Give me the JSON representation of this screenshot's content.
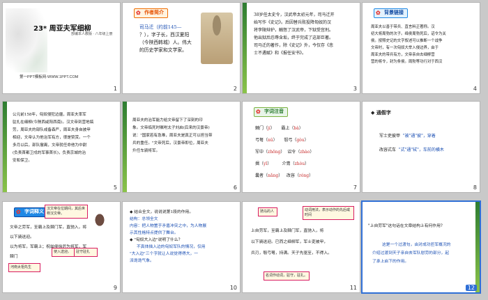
{
  "slides": [
    {
      "number": "1",
      "title": "23* 周亚夫军细柳",
      "subtitle": "部编本人教版 · 八年级上册",
      "footer": "第一PPT模板网-WWW.1PPT.COM"
    },
    {
      "number": "2",
      "tag": "作者简介",
      "line1": "司马迁（约前145—",
      "line2": "？），字子长，西汉夏阳",
      "line3": "（今陕西韩城）人。伟大",
      "line4": "的历史学家和文学家。"
    },
    {
      "number": "3",
      "line1": "38岁任太史令，汉武帝太初元年，司马迁开",
      "line2": "始写作《史记》。后因替兵败投降匈奴的汉",
      "line3": "将李陵辩护，触怒了汉武帝，下狱受宫刑。",
      "line4": "他出狱后忍辱含垢，终于完成了这部巨著。",
      "line5": "司马迁的著作，除《史记》外，今仅存《悲",
      "line6": "士不遇赋》和《报任安书》。"
    },
    {
      "number": "4",
      "tag": "背景链接",
      "line1": "周亚夫以善于带兵、直言料正著称。汉",
      "line2": "初大将周勃的次子。绛侯周勃死后，诏令为关",
      "line3": "侯。按照史记的文字叙述可以推断一个战争",
      "line4": "文帝时，有一次匈奴大举入侵边界，由于",
      "line5": "周亚夫的带兵有方，文帝亲自去细柳营",
      "line6": "营的将令，封为条侯。周勃等功行对于西汉"
    },
    {
      "number": "5",
      "line1": "公元前158年，匈奴侵犯边疆，周亚夫率军",
      "line2": "驻扎在细柳(今陕西咸阳西南)。汉文帝到营地犒",
      "line3": "劳，周亚夫的部队戒备森严，周亚夫身自披甲",
      "line4": "相迎，文帝认为他治军有方，很是赞赏。一个",
      "line5": "多月以后，部队撤离，文帝就任命他为中尉",
      "line6": "(负责首都卫戍的军事首长)，负责京城的治",
      "line7": "安和保卫。"
    },
    {
      "number": "6",
      "line1": "周亚夫的治军能力给文帝留下了深刻的印",
      "line2": "象。文帝临死时嘱咐太子刘启(后来的汉景帝)",
      "line3": "说：\"国家若有急难，周亚夫是真正可以担当带",
      "line4": "兵的重任。\"文帝死后，汉景帝即位，周亚夫",
      "line5": "升任车骑将军。"
    },
    {
      "number": "7",
      "tag": "字词注音",
      "rows": [
        {
          "word": "棘门",
          "pinyin": "jí",
          "word2": "霸上",
          "pinyin2": "bà"
        },
        {
          "word": "弓弩",
          "pinyin": "nǔ",
          "word2": "彀弓",
          "pinyin2": "gòu"
        },
        {
          "word": "军中",
          "pinyin": "zhōng",
          "word2": "诏令",
          "pinyin2": "zhào"
        },
        {
          "word": "揖",
          "pinyin": "yī",
          "word2": "介胄",
          "pinyin2": "zhòu"
        },
        {
          "word": "曩者",
          "pinyin": "nǎng",
          "word2": "改容",
          "pinyin2": "róng"
        }
      ]
    },
    {
      "number": "8",
      "heading": "◆ 通假字",
      "line1a": "军士吏披甲",
      "line1b": "\"被\"通\"披\"，穿着",
      "line2a": "改容式车",
      "line2b": "\"式\"通\"轼\"，车前的横木"
    },
    {
      "number": "9",
      "tag": "字词释义",
      "note1": "汉文帝在位期间，其后世称汉文帝。",
      "line1": "文帝之劳军，至霸上及棘门军，直驰入，将以下骑送迎。",
      "line2": "以为将军，军霸上；祝兹侯徐厉为将军，军棘门",
      "note2": "使入送迎。",
      "note3": "驻守驻扎",
      "note4": "河南太祖先生"
    },
    {
      "number": "10",
      "line1": "◆ 结合全文，说说说第1段的作用。",
      "line2": "结构：总领全文",
      "line3": "内容：把人物置于矛盾冲突之中，为人物展",
      "line4": "示其性格特点提供了舞台。",
      "line5": "◆ \"匈奴大入边\"说明了什么？",
      "line6": "不真体描入边的匈奴军队的情况，仅用",
      "line7": "\"大入边\"三个字就让人说觉得得大，一",
      "line8": "派诡诡气象。"
    },
    {
      "number": "11",
      "line1": "上自劳军，至霸上及棘门军，直驰入，将",
      "line2": "以下骑送迎。已而之细柳军，军士吏被甲，",
      "line3": "兵刃，彀弓弩，持满。天子先驱至，不得入。",
      "note1": "名词作动词，驻守，驻扎。",
      "note2": "动词用法，表示动作的先后或时间",
      "note3": "骑马的人"
    },
    {
      "number": "12",
      "q": "\"上自劳军\"这句话在文章结构上有何作用？",
      "a1": "这是一个过渡句，由对成功匝军概况的",
      "a2": "介绍过渡到天子亲自去军队慰劳的部分，起",
      "a3": "了承上启下的作用。"
    }
  ]
}
